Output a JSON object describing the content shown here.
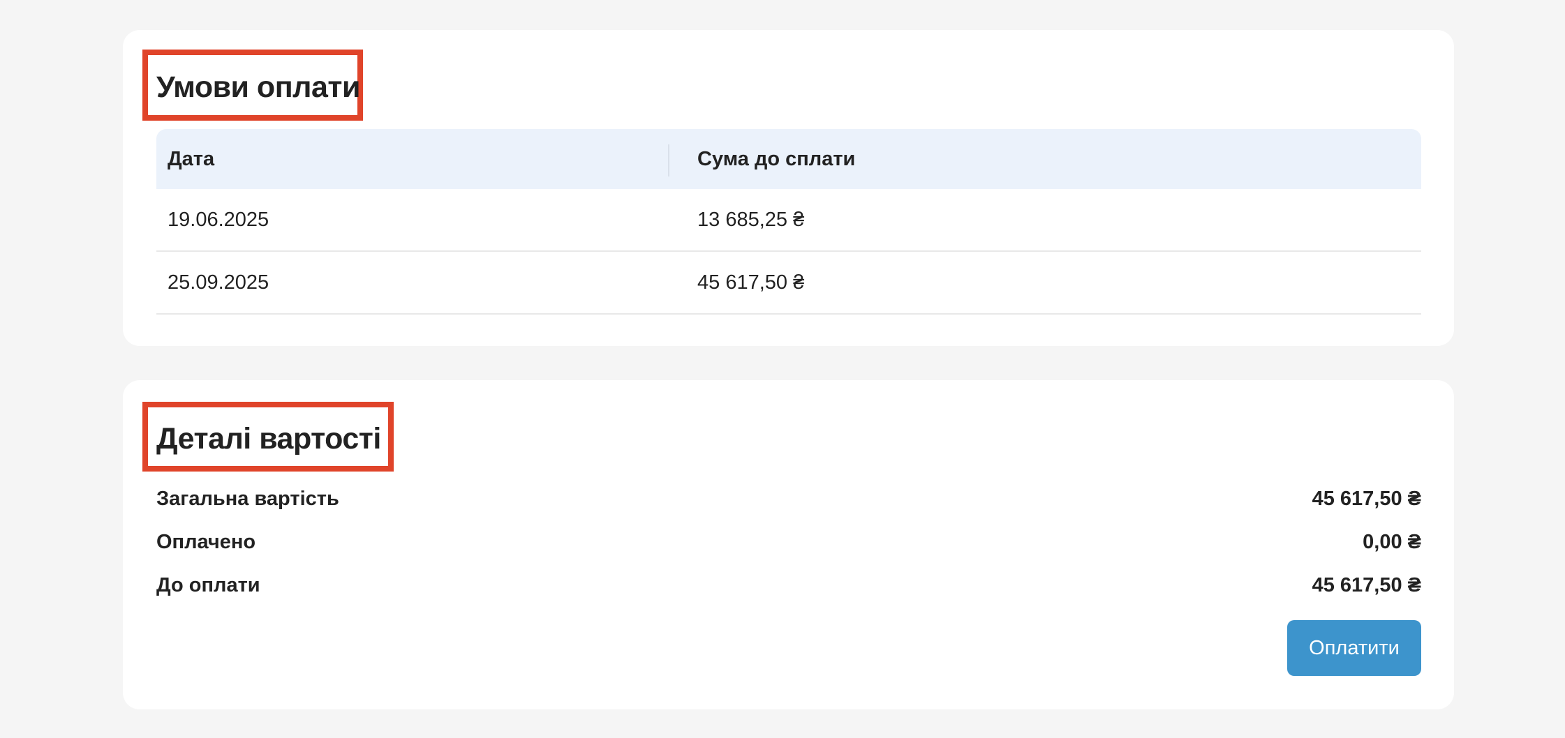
{
  "payment_terms": {
    "title": "Умови оплати",
    "columns": {
      "date": "Дата",
      "amount": "Сума до сплати"
    },
    "rows": [
      {
        "date": "19.06.2025",
        "amount": "13 685,25 ₴"
      },
      {
        "date": "25.09.2025",
        "amount": "45 617,50 ₴"
      }
    ]
  },
  "cost_details": {
    "title": "Деталі вартості",
    "items": [
      {
        "label": "Загальна вартість",
        "value": "45 617,50 ₴"
      },
      {
        "label": "Оплачено",
        "value": "0,00 ₴"
      },
      {
        "label": "До оплати",
        "value": "45 617,50 ₴"
      }
    ],
    "pay_button_label": "Оплатити"
  },
  "colors": {
    "highlight": "#e0442a",
    "button": "#3d94cc",
    "table_header_bg": "#ebf2fb",
    "page_bg": "#f5f5f5"
  }
}
